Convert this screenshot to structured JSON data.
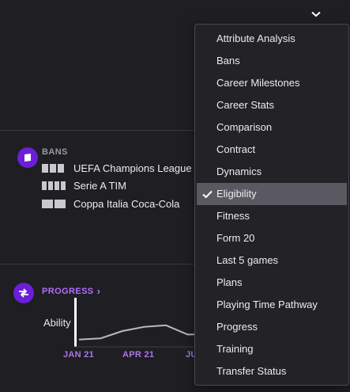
{
  "bans": {
    "title": "BANS",
    "items": [
      {
        "label": "UEFA Champions League",
        "blocks": 3
      },
      {
        "label": "Serie A TIM",
        "blocks": 4
      },
      {
        "label": "Coppa Italia Coca-Cola",
        "blocks": 2
      }
    ]
  },
  "progress": {
    "title": "PROGRESS",
    "chevron": "›",
    "y_label": "Ability",
    "x_ticks": [
      "JAN 21",
      "APR 21",
      "JU"
    ]
  },
  "chart_data": {
    "type": "line",
    "x": [
      "JAN 21",
      "APR 21",
      "JU"
    ],
    "series": [
      {
        "values": [
          0.8,
          1.2,
          3.5,
          4.8,
          5.3,
          2.4,
          2.5
        ]
      }
    ]
  },
  "dropdown": {
    "selected": "Eligibility",
    "items": [
      "Attribute Analysis",
      "Bans",
      "Career Milestones",
      "Career Stats",
      "Comparison",
      "Contract",
      "Dynamics",
      "Eligibility",
      "Fitness",
      "Form 20",
      "Last 5 games",
      "Plans",
      "Playing Time Pathway",
      "Progress",
      "Training",
      "Transfer Status"
    ]
  },
  "icons": {
    "top_toggle": "chevron-down-icon",
    "bans_section": "ban-card-icon",
    "progress_section": "progress-arrows-icon",
    "selected_marker": "checkmark-icon"
  },
  "colors": {
    "background": "#1f1e23",
    "accent_purple": "#6b1fd6",
    "progress_title": "#b46dff",
    "menu_selected": "#5a5962"
  }
}
